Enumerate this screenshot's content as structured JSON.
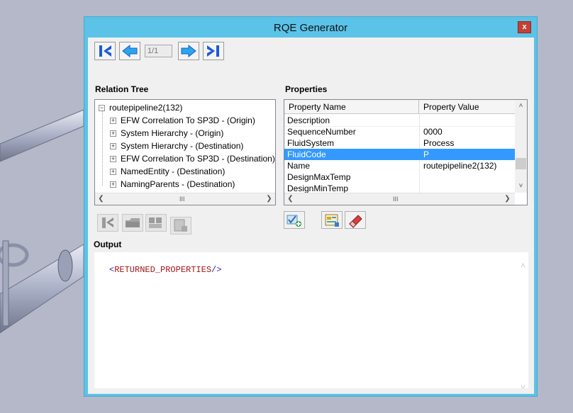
{
  "window": {
    "title": "RQE Generator",
    "close_label": "x"
  },
  "navigation": {
    "page_indicator": "1/1"
  },
  "relation_tree": {
    "heading": "Relation Tree",
    "root": {
      "expander": "−",
      "label": "routepipeline2(132)"
    },
    "children": [
      {
        "expander": "+",
        "label": "EFW Correlation To SP3D - (Origin)"
      },
      {
        "expander": "+",
        "label": "System Hierarchy - (Origin)"
      },
      {
        "expander": "+",
        "label": "System Hierarchy - (Destination)"
      },
      {
        "expander": "+",
        "label": "EFW Correlation To SP3D - (Destination)"
      },
      {
        "expander": "+",
        "label": "NamedEntity - (Destination)"
      },
      {
        "expander": "+",
        "label": "NamingParents - (Destination)"
      }
    ],
    "scroll_grip": "III"
  },
  "properties": {
    "heading": "Properties",
    "columns": [
      "Property Name",
      "Property Value"
    ],
    "rows": [
      {
        "name": "Description",
        "value": ""
      },
      {
        "name": "SequenceNumber",
        "value": "0000"
      },
      {
        "name": "FluidSystem",
        "value": "Process"
      },
      {
        "name": "FluidCode",
        "value": "P"
      },
      {
        "name": "Name",
        "value": "routepipeline2(132)"
      },
      {
        "name": "DesignMaxTemp",
        "value": ""
      },
      {
        "name": "DesignMinTemp",
        "value": ""
      }
    ],
    "selected_row": "FluidCode",
    "scroll_grip": "III"
  },
  "output": {
    "heading": "Output",
    "open_bracket": "<",
    "tag": "RETURNED_PROPERTIES",
    "close_bracket": "/>"
  },
  "colors": {
    "window_frame": "#5bc3e8",
    "selection": "#3399ff",
    "close_button": "#c44034",
    "xml_bracket": "#1f1fb8",
    "xml_tag": "#a31515"
  },
  "icons": {
    "nav": [
      "first-page-icon",
      "previous-page-icon",
      "next-page-icon",
      "last-page-icon"
    ],
    "tree_tools": [
      "relation-icon",
      "folder-icon",
      "add-object-icon",
      "document-icon"
    ],
    "property_tools": [
      "add-check-icon",
      "report-icon",
      "eraser-icon"
    ]
  }
}
